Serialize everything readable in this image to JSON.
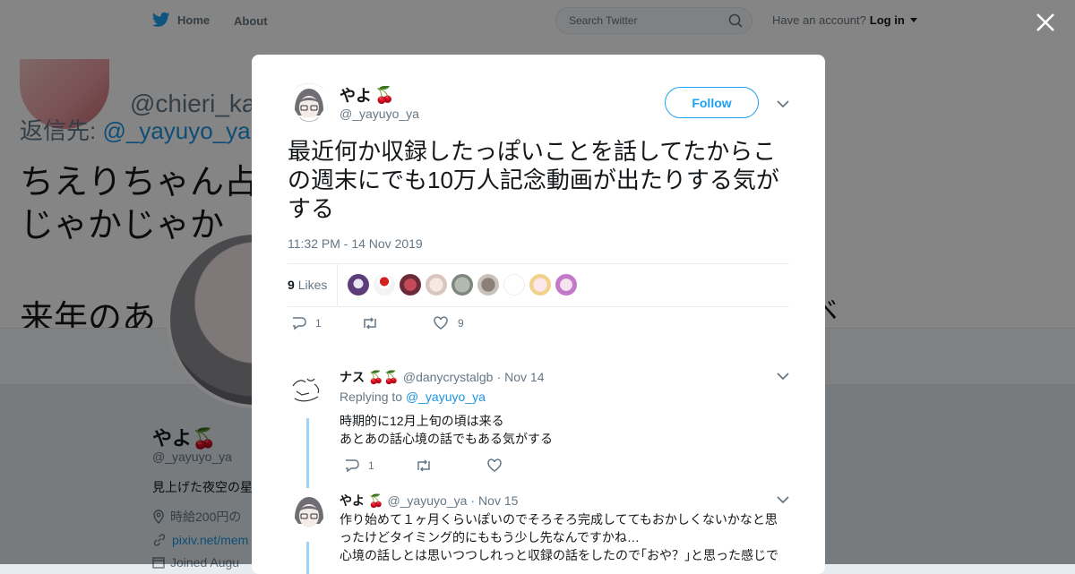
{
  "topbar": {
    "home_label": "Home",
    "about_label": "About",
    "search_placeholder": "Search Twitter",
    "have_account": "Have an account?",
    "login_label": "Log in"
  },
  "background": {
    "handle_partial": "@chieri_kakeri",
    "reply_label": "返信先:",
    "reply_handle": "@_yayuyo_ya",
    "text_line1": "ちえりちゃん占",
    "text_line2": "じゃかじゃか",
    "text_line3": "来年のあ",
    "right_glyph": "ベ",
    "profile_name": "やよ🍒",
    "profile_handle": "@_yayuyo_ya",
    "profile_bio": "見上げた夜空の星",
    "profile_location": "時給200円の",
    "profile_url": "pixiv.net/mem",
    "profile_joined": "Joined Augu"
  },
  "tweet": {
    "name": "やよ",
    "name_emoji": "🍒",
    "handle": "@_yayuyo_ya",
    "follow_label": "Follow",
    "text": "最近何か収録したっぽいことを話してたからこの週末にでも10万人記念動画が出たりする気がする",
    "timestamp": "11:32 PM - 14 Nov 2019",
    "likes_count": "9",
    "likes_label": "Likes",
    "reply_count": "1",
    "retweet_count": "",
    "like_count": "9"
  },
  "colors": {
    "accent": "#1da1f2",
    "link": "#1b95e0",
    "muted": "#657786"
  },
  "replies": [
    {
      "name": "ナス",
      "name_emoji": "🍒🍒",
      "handle": "@danycrystalgb",
      "date": "Nov 14",
      "replying_label": "Replying to",
      "replying_handle": "@_yayuyo_ya",
      "line1": "時期的に12月上旬の頃は来る",
      "line2": "あとあの話心境の話でもある気がする",
      "reply_count": "1"
    },
    {
      "name": "やよ",
      "name_emoji": "🍒",
      "handle": "@_yayuyo_ya",
      "date": "Nov 15",
      "line1": "作り始めて１ヶ月くらいぽいのでそろそろ完成しててもおかしくないかなと思ったけどタイミング的にももう少し先なんですかね…",
      "line2": "心境の話しとは思いつつしれっと収録の話をしたので｢おや？｣と思った感じで"
    }
  ]
}
